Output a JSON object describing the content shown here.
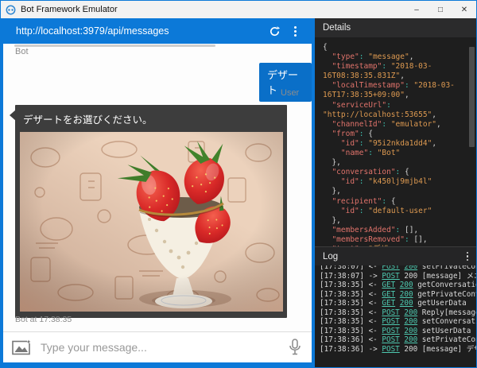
{
  "window": {
    "title": "Bot Framework Emulator",
    "controls": {
      "minimize": "–",
      "maximize": "□",
      "close": "✕"
    }
  },
  "address_bar": {
    "url": "http://localhost:3979/api/messages"
  },
  "chat": {
    "bot_label": "Bot",
    "user_label": "User",
    "user_message": "デザート",
    "bot_message": "デザートをお選びください。",
    "bot_timestamp": "Bot at 17:38:35",
    "input_placeholder": "Type your message..."
  },
  "details": {
    "title": "Details",
    "json_lines": [
      [
        {
          "c": "p",
          "t": "{"
        }
      ],
      [
        {
          "c": "p",
          "t": "  "
        },
        {
          "c": "k",
          "t": "\"type\""
        },
        {
          "c": "c",
          "t": ": "
        },
        {
          "c": "s",
          "t": "\"message\""
        },
        {
          "c": "p",
          "t": ","
        }
      ],
      [
        {
          "c": "p",
          "t": "  "
        },
        {
          "c": "k",
          "t": "\"timestamp\""
        },
        {
          "c": "c",
          "t": ": "
        },
        {
          "c": "s",
          "t": "\"2018-03-"
        }
      ],
      [
        {
          "c": "s",
          "t": "16T08:38:35.831Z\""
        },
        {
          "c": "p",
          "t": ","
        }
      ],
      [
        {
          "c": "p",
          "t": "  "
        },
        {
          "c": "k",
          "t": "\"localTimestamp\""
        },
        {
          "c": "c",
          "t": ": "
        },
        {
          "c": "s",
          "t": "\"2018-03-"
        }
      ],
      [
        {
          "c": "s",
          "t": "16T17:38:35+09:00\""
        },
        {
          "c": "p",
          "t": ","
        }
      ],
      [
        {
          "c": "p",
          "t": "  "
        },
        {
          "c": "k",
          "t": "\"serviceUrl\""
        },
        {
          "c": "c",
          "t": ":"
        }
      ],
      [
        {
          "c": "s",
          "t": "\"http://localhost:53655\""
        },
        {
          "c": "p",
          "t": ","
        }
      ],
      [
        {
          "c": "p",
          "t": "  "
        },
        {
          "c": "k",
          "t": "\"channelId\""
        },
        {
          "c": "c",
          "t": ": "
        },
        {
          "c": "s",
          "t": "\"emulator\""
        },
        {
          "c": "p",
          "t": ","
        }
      ],
      [
        {
          "c": "p",
          "t": "  "
        },
        {
          "c": "k",
          "t": "\"from\""
        },
        {
          "c": "c",
          "t": ": "
        },
        {
          "c": "p",
          "t": "{"
        }
      ],
      [
        {
          "c": "p",
          "t": "    "
        },
        {
          "c": "k",
          "t": "\"id\""
        },
        {
          "c": "c",
          "t": ": "
        },
        {
          "c": "s",
          "t": "\"95i2nkda1dd4\""
        },
        {
          "c": "p",
          "t": ","
        }
      ],
      [
        {
          "c": "p",
          "t": "    "
        },
        {
          "c": "k",
          "t": "\"name\""
        },
        {
          "c": "c",
          "t": ": "
        },
        {
          "c": "s",
          "t": "\"Bot\""
        }
      ],
      [
        {
          "c": "p",
          "t": "  },"
        }
      ],
      [
        {
          "c": "p",
          "t": "  "
        },
        {
          "c": "k",
          "t": "\"conversation\""
        },
        {
          "c": "c",
          "t": ": "
        },
        {
          "c": "p",
          "t": "{"
        }
      ],
      [
        {
          "c": "p",
          "t": "    "
        },
        {
          "c": "k",
          "t": "\"id\""
        },
        {
          "c": "c",
          "t": ": "
        },
        {
          "c": "s",
          "t": "\"k450lj9mjb4l\""
        }
      ],
      [
        {
          "c": "p",
          "t": "  },"
        }
      ],
      [
        {
          "c": "p",
          "t": "  "
        },
        {
          "c": "k",
          "t": "\"recipient\""
        },
        {
          "c": "c",
          "t": ": "
        },
        {
          "c": "p",
          "t": "{"
        }
      ],
      [
        {
          "c": "p",
          "t": "    "
        },
        {
          "c": "k",
          "t": "\"id\""
        },
        {
          "c": "c",
          "t": ": "
        },
        {
          "c": "s",
          "t": "\"default-user\""
        }
      ],
      [
        {
          "c": "p",
          "t": "  },"
        }
      ],
      [
        {
          "c": "p",
          "t": "  "
        },
        {
          "c": "k",
          "t": "\"membersAdded\""
        },
        {
          "c": "c",
          "t": ": "
        },
        {
          "c": "p",
          "t": "[],"
        }
      ],
      [
        {
          "c": "p",
          "t": "  "
        },
        {
          "c": "k",
          "t": "\"membersRemoved\""
        },
        {
          "c": "c",
          "t": ": "
        },
        {
          "c": "p",
          "t": "[],"
        }
      ],
      [
        {
          "c": "p",
          "t": "  "
        },
        {
          "c": "k",
          "t": "\"text\""
        },
        {
          "c": "c",
          "t": ": "
        },
        {
          "c": "s",
          "t": "\"デザー"
        }
      ]
    ]
  },
  "log": {
    "title": "Log",
    "entries": [
      {
        "time": "[17:38:07]",
        "dir": "<-",
        "method": "POST",
        "status": "200",
        "status_link": true,
        "text": "setPrivateConversationData",
        "clipped": true
      },
      {
        "time": "[17:38:07]",
        "dir": "->",
        "method": "POST",
        "status": "200",
        "status_link": false,
        "text": "[message] メニュー"
      },
      {
        "time": "[17:38:35]",
        "dir": "<-",
        "method": "GET",
        "status": "200",
        "status_link": true,
        "text": "getConversationData"
      },
      {
        "time": "[17:38:35]",
        "dir": "<-",
        "method": "GET",
        "status": "200",
        "status_link": true,
        "text": "getPrivateConversationData"
      },
      {
        "time": "[17:38:35]",
        "dir": "<-",
        "method": "GET",
        "status": "200",
        "status_link": true,
        "text": "getUserData"
      },
      {
        "time": "[17:38:35]",
        "dir": "<-",
        "method": "POST",
        "status": "200",
        "status_link": true,
        "text": "Reply[message]"
      },
      {
        "time": "[17:38:35]",
        "dir": "<-",
        "method": "POST",
        "status": "200",
        "status_link": true,
        "text": "setConversationData"
      },
      {
        "time": "[17:38:35]",
        "dir": "<-",
        "method": "POST",
        "status": "200",
        "status_link": true,
        "text": "setUserData"
      },
      {
        "time": "[17:38:36]",
        "dir": "<-",
        "method": "POST",
        "status": "200",
        "status_link": true,
        "text": "setPrivateConversationData"
      },
      {
        "time": "[17:38:36]",
        "dir": "->",
        "method": "POST",
        "status": "200",
        "status_link": false,
        "text": "[message] デザート"
      }
    ]
  },
  "colors": {
    "accent_blue": "#0c79d8",
    "user_bubble": "#0a6fc8",
    "bot_card": "#3d3d3d",
    "panel_bg": "#1e1e1e",
    "json_key": "#e0736b",
    "json_string": "#de9a51",
    "log_link": "#4ec9b0"
  }
}
